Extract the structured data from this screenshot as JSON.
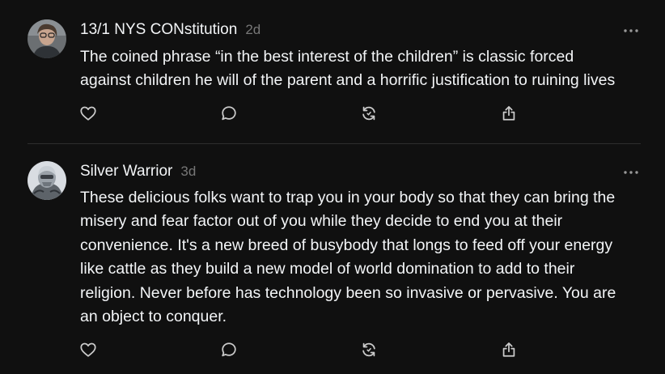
{
  "colors": {
    "background": "#101010",
    "primary_text": "#f3f5f7",
    "secondary_text": "#777777",
    "icon": "#cccccc",
    "divider": "#2d2d2d"
  },
  "posts": [
    {
      "author": "13/1 NYS CONstitution",
      "time": "2d",
      "text_lines": [
        "The coined phrase “in the best interest of the children” is classic forced",
        "against children he will of the parent and a horrific justification to ruining lives"
      ],
      "icons": [
        "heart-icon",
        "comment-icon",
        "repost-icon",
        "share-icon",
        "more-icon"
      ]
    },
    {
      "author": "Silver Warrior",
      "time": "3d",
      "text_lines": [
        "These delicious folks want to trap you in your body so that they can bring the",
        "misery and fear factor out of you while they decide to end you at their",
        "convenience. It's a new breed of busybody that longs to feed off your energy",
        "like cattle as they build a new model of world domination to add to their",
        "religion. Never before has technology been so invasive or pervasive. You are",
        "an object to conquer."
      ],
      "icons": [
        "heart-icon",
        "comment-icon",
        "repost-icon",
        "share-icon",
        "more-icon"
      ]
    }
  ]
}
